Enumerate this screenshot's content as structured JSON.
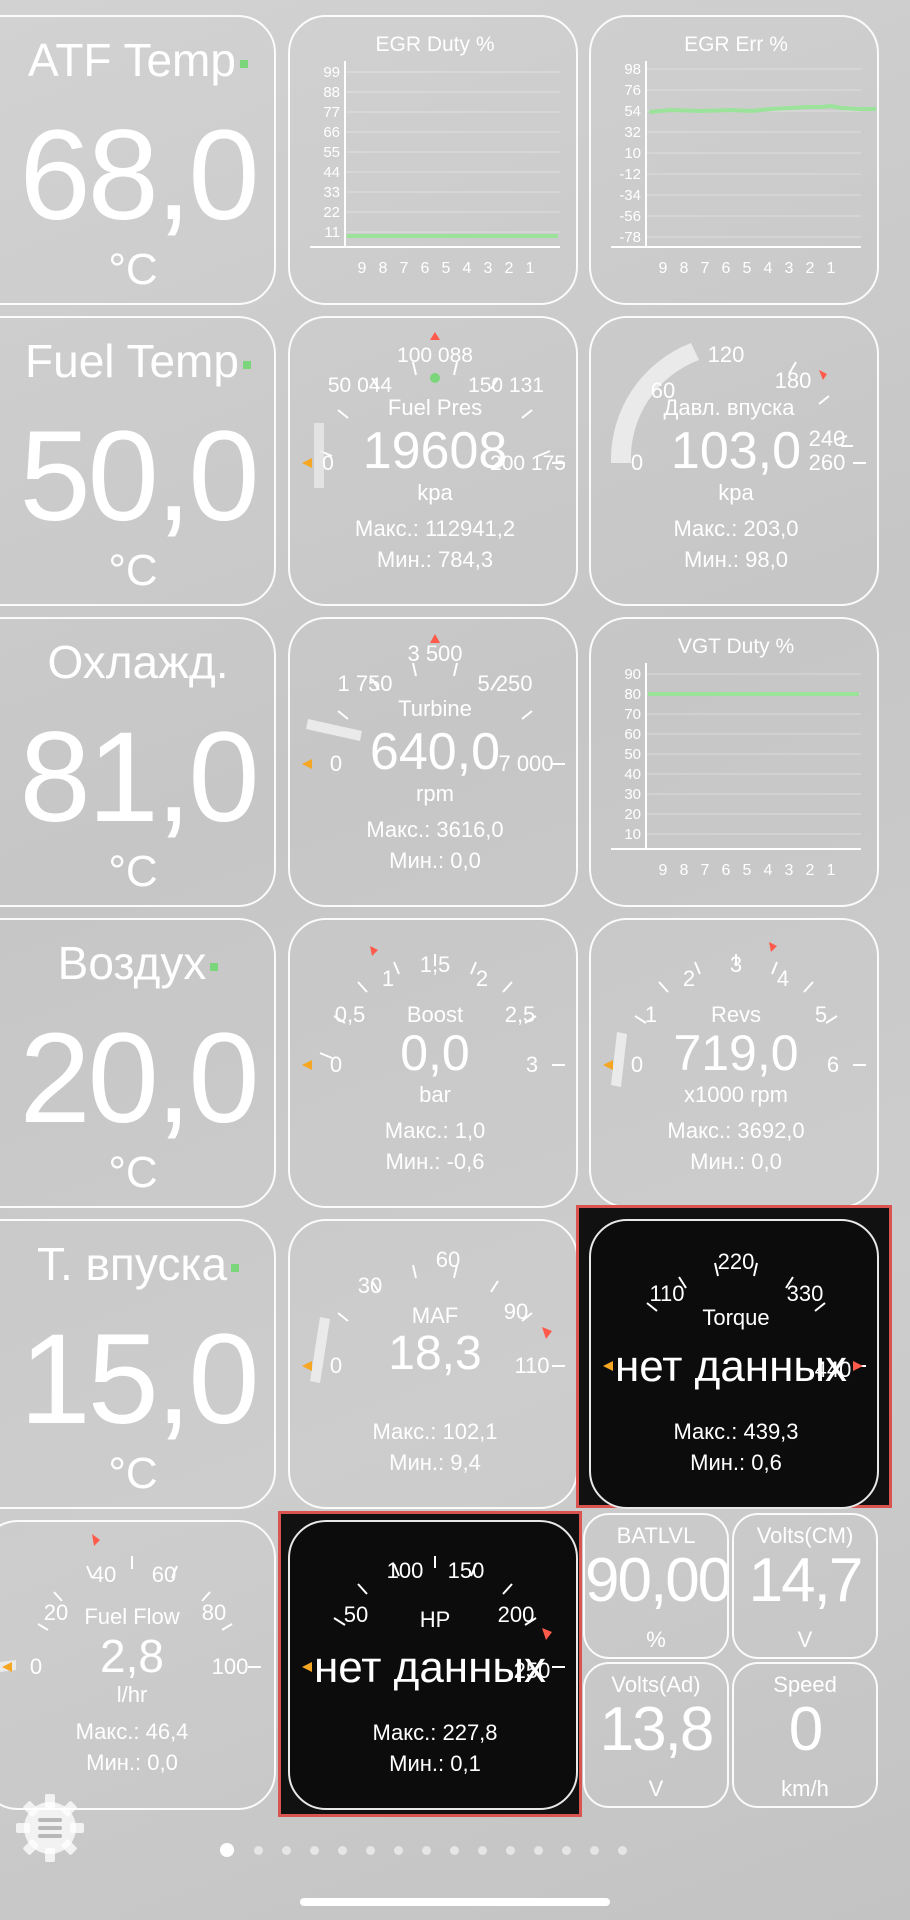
{
  "big_tiles": [
    {
      "label": "ATF Temp",
      "value": "68,0",
      "unit": "°C"
    },
    {
      "label": "Fuel Temp",
      "value": "50,0",
      "unit": "°C"
    },
    {
      "label": "Охлажд.",
      "value": "81,0",
      "unit": "°C"
    },
    {
      "label": "Воздух",
      "value": "20,0",
      "unit": "°C"
    },
    {
      "label": "Т. впуска",
      "value": "15,0",
      "unit": "°C"
    }
  ],
  "graphs": {
    "egr_duty": {
      "title": "EGR Duty  %",
      "y_ticks": [
        "99",
        "88",
        "77",
        "66",
        "55",
        "44",
        "33",
        "22",
        "11"
      ],
      "x_ticks": [
        "9",
        "8",
        "7",
        "6",
        "5",
        "4",
        "3",
        "2",
        "1"
      ],
      "level_percent": 9
    },
    "egr_err": {
      "title": "EGR Err  %",
      "y_ticks": [
        "98",
        "76",
        "54",
        "32",
        "10",
        "-12",
        "-34",
        "-56",
        "-78"
      ],
      "x_ticks": [
        "9",
        "8",
        "7",
        "6",
        "5",
        "4",
        "3",
        "2",
        "1"
      ]
    },
    "vgt_duty": {
      "title": "VGT Duty  %",
      "y_ticks": [
        "90",
        "80",
        "70",
        "60",
        "50",
        "40",
        "30",
        "20",
        "10"
      ],
      "x_ticks": [
        "9",
        "8",
        "7",
        "6",
        "5",
        "4",
        "3",
        "2",
        "1"
      ],
      "level_percent": 80
    }
  },
  "gauges": {
    "fuel_pres": {
      "name": "Fuel Pres",
      "value": "19608",
      "unit": "kpa",
      "max": "Макс.: 112941,2",
      "min": "Мин.: 784,3",
      "ticks": [
        "0",
        "50 044",
        "100 088",
        "150 131",
        "200 175"
      ]
    },
    "intake_pres": {
      "name": "Давл. впуска",
      "value": "103,0",
      "unit": "kpa",
      "max": "Макс.: 203,0",
      "min": "Мин.: 98,0",
      "ticks": [
        "0",
        "60",
        "120",
        "180",
        "240",
        "260"
      ]
    },
    "turbine": {
      "name": "Turbine",
      "value": "640,0",
      "unit": "rpm",
      "max": "Макс.: 3616,0",
      "min": "Мин.: 0,0",
      "ticks": [
        "0",
        "1 750",
        "3 500",
        "5 250",
        "7 000"
      ]
    },
    "boost": {
      "name": "Boost",
      "value": "0,0",
      "unit": "bar",
      "max": "Макс.: 1,0",
      "min": "Мин.: -0,6",
      "ticks": [
        "0",
        "0,5",
        "1",
        "1,5",
        "2",
        "2,5",
        "3"
      ]
    },
    "revs": {
      "name": "Revs",
      "value": "719,0",
      "unit": "x1000 rpm",
      "max": "Макс.: 3692,0",
      "min": "Мин.: 0,0",
      "ticks": [
        "0",
        "1",
        "2",
        "3",
        "4",
        "5",
        "6"
      ]
    },
    "maf": {
      "name": "MAF",
      "value": "18,3",
      "unit": "",
      "max": "Макс.: 102,1",
      "min": "Мин.: 9,4",
      "ticks": [
        "0",
        "30",
        "60",
        "90",
        "110"
      ]
    },
    "torque": {
      "name": "Torque",
      "value": "нет данных",
      "unit": "",
      "max": "Макс.: 439,3",
      "min": "Мин.: 0,6",
      "ticks": [
        "110",
        "220",
        "330",
        "440"
      ]
    },
    "fuel_flow": {
      "name": "Fuel Flow",
      "value": "2,8",
      "unit": "l/hr",
      "max": "Макс.: 46,4",
      "min": "Мин.: 0,0",
      "ticks": [
        "0",
        "20",
        "40",
        "60",
        "80",
        "100"
      ]
    },
    "hp": {
      "name": "HP",
      "value": "нет данных",
      "unit": "",
      "max": "Макс.: 227,8",
      "min": "Мин.: 0,1",
      "ticks": [
        "50",
        "100",
        "150",
        "200",
        "250"
      ]
    }
  },
  "small_tiles": [
    {
      "label": "BATLVL",
      "value": "90,00",
      "unit": "%"
    },
    {
      "label": "Volts(CM)",
      "value": "14,7",
      "unit": "V"
    },
    {
      "label": "Volts(Ad)",
      "value": "13,8",
      "unit": "V"
    },
    {
      "label": "Speed",
      "value": "0",
      "unit": "km/h"
    }
  ],
  "colors": {
    "accent_green": "#7bd67b",
    "warning_red": "#ff5a4a",
    "pointer_orange": "#f5a623",
    "highlight": "#d9534f"
  },
  "icons": {
    "settings": "gear-menu-icon"
  }
}
